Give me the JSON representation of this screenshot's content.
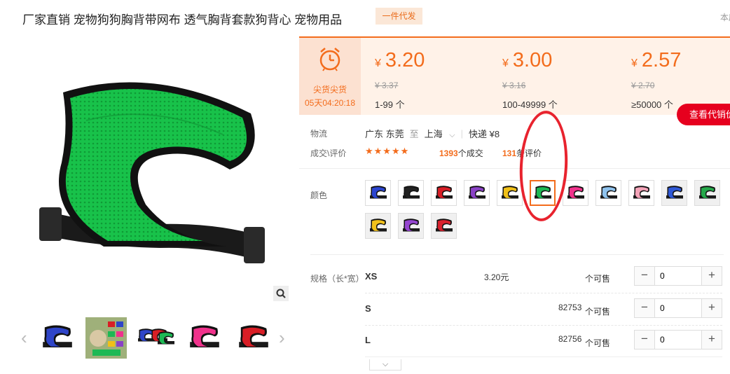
{
  "product": {
    "title": "厂家直销 宠物狗狗胸背带网布 透气胸背套款狗背心 宠物用品",
    "badge": "一件代发",
    "corner_text": "本店"
  },
  "gallery": {
    "main_image": "green-mesh-dog-harness",
    "thumbnails": [
      {
        "name": "blue-harness",
        "color": "#2f45c8"
      },
      {
        "name": "dog-photo-collage",
        "color": "#8a7a4a"
      },
      {
        "name": "multi-harness",
        "color": "#333333"
      },
      {
        "name": "pink-harness",
        "color": "#f0328c"
      },
      {
        "name": "red-harness",
        "color": "#d81e26"
      }
    ]
  },
  "flash_sale": {
    "label": "尖货尖货",
    "timer": "05天04:20:18"
  },
  "tiers": [
    {
      "currency": "¥",
      "price": "3.20",
      "original": "¥ 3.37",
      "range": "1-99 个"
    },
    {
      "currency": "¥",
      "price": "3.00",
      "original": "¥ 3.16",
      "range": "100-49999 个"
    },
    {
      "currency": "¥",
      "price": "2.57",
      "original": "¥ 2.70",
      "range": "≥50000 个"
    }
  ],
  "see_agent_button": "查看代销价",
  "logistics": {
    "label": "物流",
    "from": "广东 东莞",
    "to_word": "至",
    "to": "上海",
    "shipping": "快递 ¥8"
  },
  "sales": {
    "label": "成交\\评价",
    "stars": "★★★★★",
    "deals_count": "1393",
    "deals_suffix": "个成交",
    "review_count": "131",
    "review_suffix": "条评价"
  },
  "colors": {
    "label": "颜色",
    "swatches": [
      {
        "name": "blue",
        "color": "#2b45d0",
        "bg": false
      },
      {
        "name": "black",
        "color": "#222222",
        "bg": false
      },
      {
        "name": "red",
        "color": "#d81e26",
        "bg": false
      },
      {
        "name": "purple",
        "color": "#8a42c6",
        "bg": false
      },
      {
        "name": "yellow",
        "color": "#f0c018",
        "bg": false
      },
      {
        "name": "green",
        "color": "#1db954",
        "bg": false,
        "selected": true
      },
      {
        "name": "pink",
        "color": "#f0328c",
        "bg": false
      },
      {
        "name": "light-blue",
        "color": "#8fc3ee",
        "bg": false
      },
      {
        "name": "light-pink",
        "color": "#f4a3b8",
        "bg": false
      },
      {
        "name": "blue-2",
        "color": "#2f58d6",
        "bg": true
      },
      {
        "name": "green-2",
        "color": "#25a84a",
        "bg": true
      },
      {
        "name": "yellow-2",
        "color": "#f2c11c",
        "bg": true
      },
      {
        "name": "purple-2",
        "color": "#9546d0",
        "bg": true
      },
      {
        "name": "red-2",
        "color": "#d8212d",
        "bg": true
      }
    ]
  },
  "specs": {
    "label": "规格（长*宽）",
    "rows": [
      {
        "size": "XS",
        "price": "3.20元",
        "stock": "",
        "available": "个可售",
        "qty": "0"
      },
      {
        "size": "S",
        "price": "",
        "stock": "82753",
        "available": "个可售",
        "qty": "0"
      },
      {
        "size": "L",
        "price": "",
        "stock": "82756",
        "available": "个可售",
        "qty": "0"
      }
    ]
  },
  "accent_color": "#f36c1c"
}
